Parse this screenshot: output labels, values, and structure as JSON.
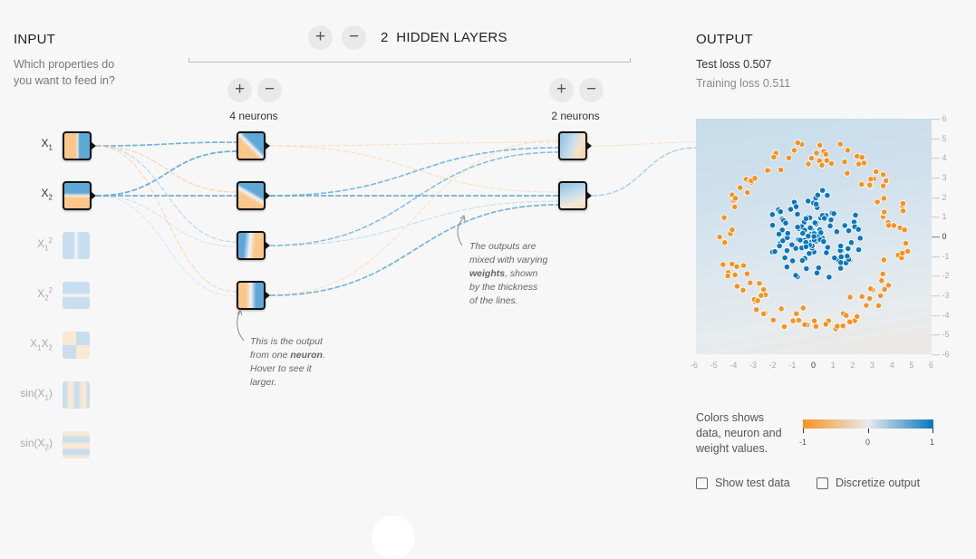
{
  "input": {
    "title": "INPUT",
    "subtitle_line1": "Which properties do",
    "subtitle_line2": "you want to feed in?",
    "features": [
      {
        "label": "X",
        "sub": "1",
        "sup": "",
        "active": true
      },
      {
        "label": "X",
        "sub": "2",
        "sup": "",
        "active": true
      },
      {
        "label": "X",
        "sub": "1",
        "sup": "2",
        "active": false
      },
      {
        "label": "X",
        "sub": "2",
        "sup": "2",
        "active": false
      },
      {
        "label": "X1X2",
        "sub": "",
        "sup": "",
        "active": false
      },
      {
        "label": "sin(X1)",
        "sub": "",
        "sup": "",
        "active": false
      },
      {
        "label": "sin(X2)",
        "sub": "",
        "sup": "",
        "active": false
      }
    ]
  },
  "hidden": {
    "count": "2",
    "title": "HIDDEN LAYERS",
    "add_layer_icon": "plus-icon",
    "remove_layer_icon": "minus-icon",
    "plus": "+",
    "minus": "−",
    "layers": [
      {
        "neurons_label": "4 neurons",
        "neurons": 4
      },
      {
        "neurons_label": "2 neurons",
        "neurons": 2
      }
    ]
  },
  "notes": {
    "neuron": {
      "line1": "This is the output",
      "line2_pre": "from one ",
      "line2_bold": "neuron",
      "line2_post": ".",
      "line3": "Hover to see it",
      "line4": "larger."
    },
    "weights": {
      "line1": "The outputs are",
      "line2": "mixed with varying",
      "line3_bold": "weights",
      "line3_post": ", shown",
      "line4": "by the thickness",
      "line5": "of the lines."
    }
  },
  "output": {
    "title": "OUTPUT",
    "test_loss_label": "Test loss",
    "test_loss": "0.507",
    "training_loss_label": "Training loss",
    "training_loss": "0.511",
    "x_ticks": [
      "-6",
      "-5",
      "-4",
      "-3",
      "-2",
      "-1",
      "0",
      "1",
      "2",
      "3",
      "4",
      "5",
      "6"
    ],
    "y_ticks": [
      "6",
      "5",
      "4",
      "3",
      "2",
      "1",
      "0",
      "-1",
      "-2",
      "-3",
      "-4",
      "-5",
      "-6"
    ],
    "legend_text_line1": "Colors shows",
    "legend_text_line2": "data, neuron and",
    "legend_text_line3": "weight values.",
    "legend_min": "-1",
    "legend_mid": "0",
    "legend_max": "1",
    "show_test_data": "Show test data",
    "discretize_output": "Discretize output"
  },
  "colors": {
    "orange": "#f59322",
    "blue": "#0877bd",
    "light_orange": "#fbc689",
    "light_blue": "#5ea8d8"
  }
}
